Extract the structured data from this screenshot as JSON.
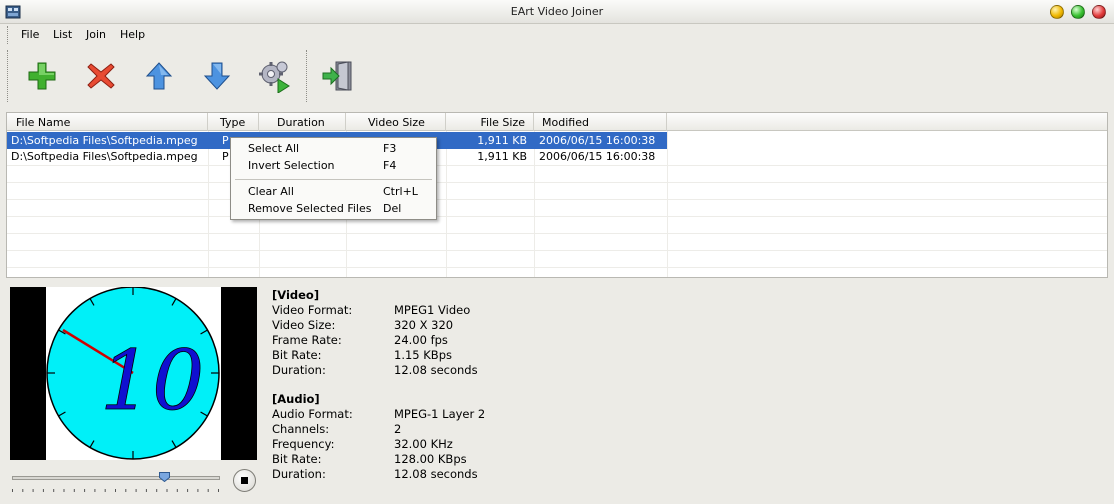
{
  "window": {
    "title": "EArt Video Joiner"
  },
  "menu": {
    "file": "File",
    "list": "List",
    "join": "Join",
    "help": "Help"
  },
  "toolbar": {
    "buttons": [
      "add-icon",
      "remove-icon",
      "move-up-icon",
      "move-down-icon",
      "join-settings-icon",
      "exit-icon"
    ]
  },
  "file_list": {
    "columns": [
      "File Name",
      "Type",
      "Duration",
      "Video Size",
      "File Size",
      "Modified"
    ],
    "rows": [
      {
        "file_name": "D:\\Softpedia Files\\Softpedia.mpeg",
        "type": "P",
        "file_size": "1,911 KB",
        "modified": "2006/06/15 16:00:38",
        "selected": true
      },
      {
        "file_name": "D:\\Softpedia Files\\Softpedia.mpeg",
        "type": "P",
        "file_size": "1,911 KB",
        "modified": "2006/06/15 16:00:38",
        "selected": false
      }
    ]
  },
  "context_menu": {
    "select_all": "Select All",
    "select_all_key": "F3",
    "invert_selection": "Invert Selection",
    "invert_selection_key": "F4",
    "clear_all": "Clear All",
    "clear_all_key": "Ctrl+L",
    "remove_selected": "Remove Selected Files",
    "remove_selected_key": "Del"
  },
  "preview": {
    "frame_text": "10",
    "slider_position": 0.73
  },
  "info": {
    "video_header": "[Video]",
    "video_format_label": "Video Format:",
    "video_format": "MPEG1 Video",
    "video_size_label": "Video Size:",
    "video_size": "320 X 320",
    "frame_rate_label": "Frame Rate:",
    "frame_rate": "24.00 fps",
    "video_bit_rate_label": "Bit Rate:",
    "video_bit_rate": "1.15 KBps",
    "video_duration_label": "Duration:",
    "video_duration": "12.08 seconds",
    "audio_header": "[Audio]",
    "audio_format_label": "Audio Format:",
    "audio_format": "MPEG-1 Layer 2",
    "channels_label": "Channels:",
    "channels": "2",
    "frequency_label": "Frequency:",
    "frequency": "32.00 KHz",
    "audio_bit_rate_label": "Bit Rate:",
    "audio_bit_rate": "128.00 KBps",
    "audio_duration_label": "Duration:",
    "audio_duration": "12.08 seconds"
  },
  "colors": {
    "selection": "#316ac5",
    "clock_face": "#00f0f8",
    "clock_digits": "#1010d0",
    "clock_hand": "#d00000"
  }
}
